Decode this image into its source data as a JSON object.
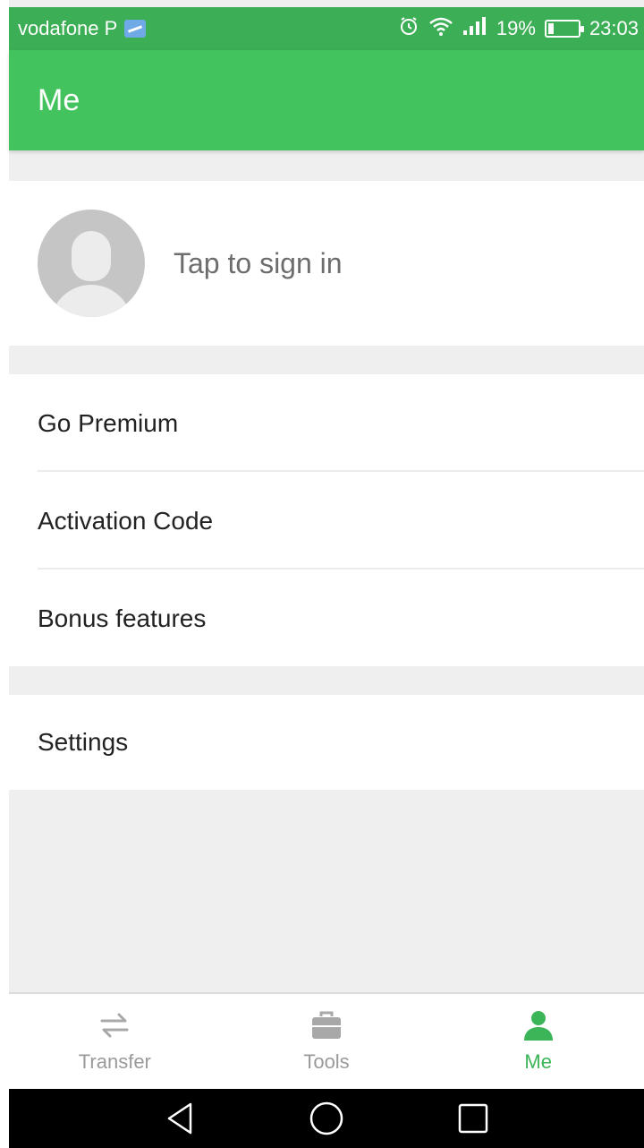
{
  "status_bar": {
    "carrier": "vodafone P",
    "battery_percent": "19%",
    "battery_level": 0.19,
    "time": "23:03",
    "icons": [
      "alarm-icon",
      "wifi-icon",
      "signal-icon",
      "battery-icon"
    ]
  },
  "app_bar": {
    "title": "Me"
  },
  "profile": {
    "sign_in_text": "Tap to sign in",
    "avatar_icon": "avatar-placeholder-icon"
  },
  "menu": {
    "items": [
      {
        "label": "Go Premium"
      },
      {
        "label": "Activation Code"
      },
      {
        "label": "Bonus features"
      }
    ],
    "settings_label": "Settings"
  },
  "bottom_nav": {
    "tabs": [
      {
        "label": "Transfer",
        "icon": "transfer-icon",
        "active": false
      },
      {
        "label": "Tools",
        "icon": "toolbox-icon",
        "active": false
      },
      {
        "label": "Me",
        "icon": "person-icon",
        "active": true
      }
    ],
    "active_color": "#3cb558",
    "inactive_color": "#9a9a9a"
  },
  "system_nav": {
    "icons": [
      "back-icon",
      "home-icon",
      "recents-icon"
    ]
  },
  "colors": {
    "status_bar": "#3cae55",
    "app_bar": "#43c35e",
    "background": "#efefef"
  }
}
